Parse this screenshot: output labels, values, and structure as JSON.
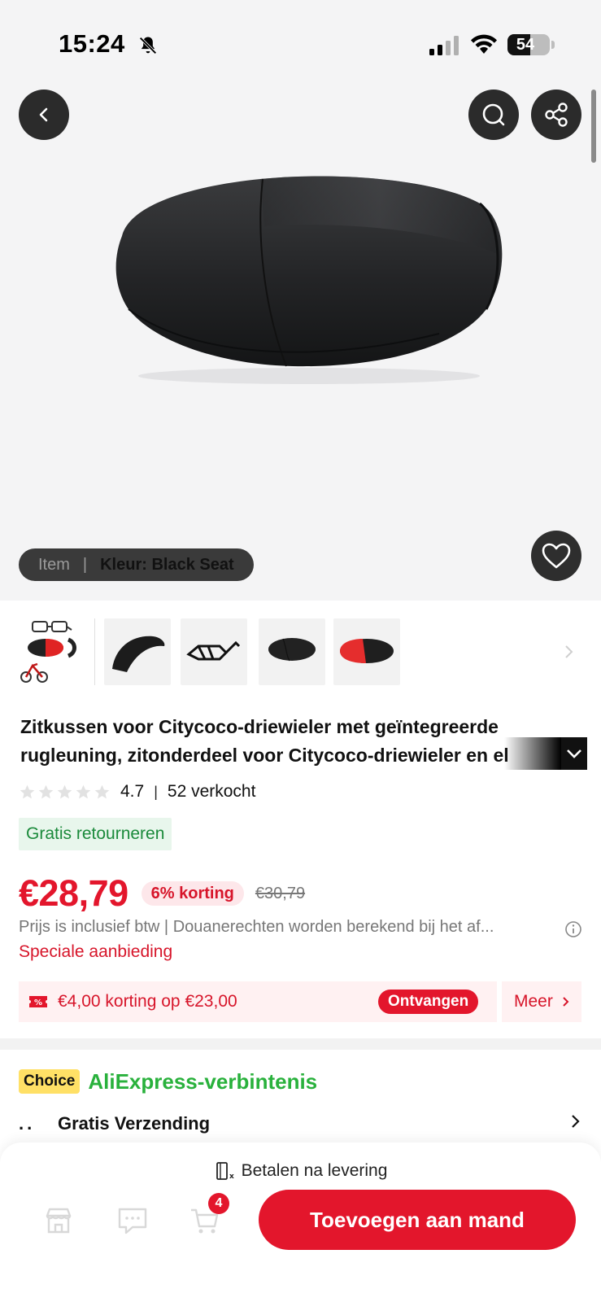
{
  "status_bar": {
    "time": "15:24",
    "battery": "54",
    "battery_level": 0.54
  },
  "hero": {
    "sku_item_label": "Item",
    "sku_separator": "|",
    "sku_color_label": "Kleur: Black Seat"
  },
  "product": {
    "title_line1": "Zitkussen voor Citycoco-driewieler met geïntegreerde",
    "title_line2": "rugleuning, zitonderdeel voor Citycoco-driewieler en el",
    "rating": "4.7",
    "rating_separator": "|",
    "sold": "52 verkocht",
    "rating_stars": 0,
    "free_returns": "Gratis retourneren",
    "price": "€28,79",
    "discount": "6% korting",
    "old_price": "€30,79",
    "tax_note": "Prijs is inclusief btw | Douanerechten worden berekend bij het af...",
    "special_offer": "Speciale aanbieding"
  },
  "coupon": {
    "text": "€4,00 korting op €23,00",
    "claim_label": "Ontvangen",
    "more_label": "Meer"
  },
  "choice": {
    "badge": "Choice",
    "title": "AliExpress-verbintenis",
    "shipping_dots": "..",
    "shipping_label": "Gratis Verzending"
  },
  "bottom_bar": {
    "pay_later": "Betalen na levering",
    "cart_count": "4",
    "add_to_cart": "Toevoegen aan mand"
  },
  "colors": {
    "accent": "#e3162c",
    "choice_green": "#29b13c",
    "choice_badge": "#ffe066",
    "returns_green": "#1b8a3b"
  },
  "icons": [
    "bell-off-icon",
    "signal-icon",
    "wifi-icon",
    "back-icon",
    "search-icon",
    "share-icon",
    "heart-icon",
    "star-icon",
    "chevron-right-icon",
    "chevron-down-icon",
    "info-icon",
    "coupon-icon",
    "pay-later-icon",
    "store-icon",
    "chat-icon",
    "cart-icon"
  ]
}
